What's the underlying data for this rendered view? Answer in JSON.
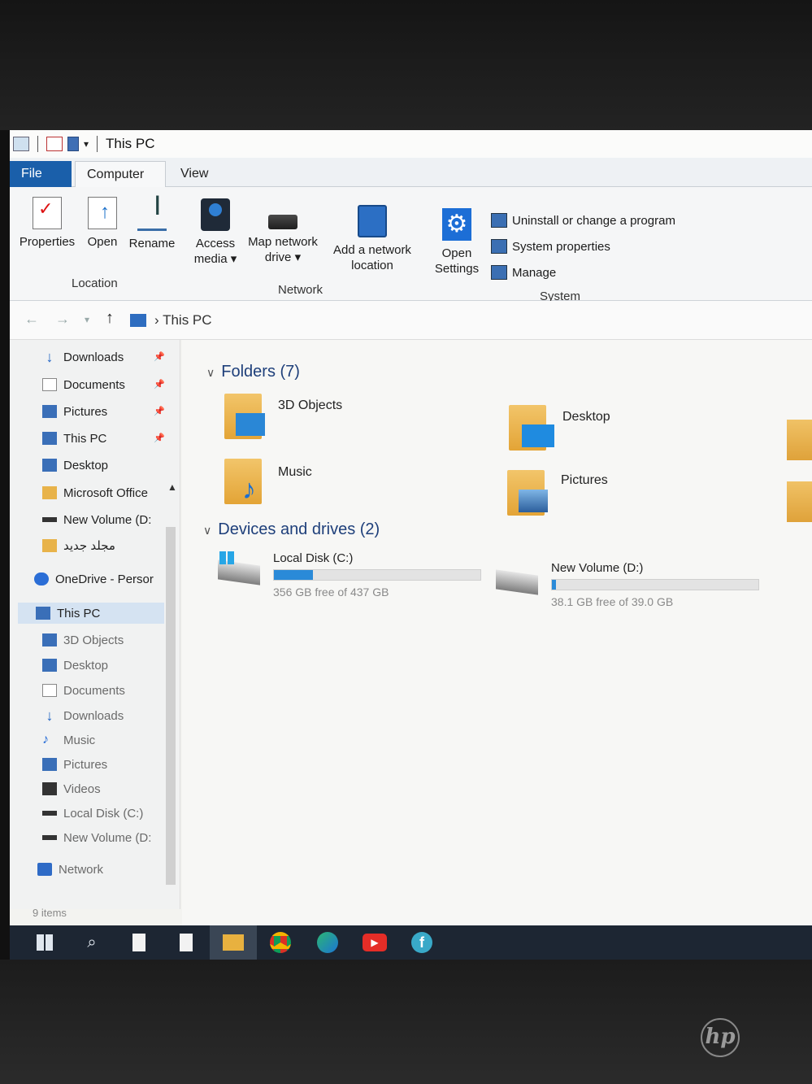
{
  "window": {
    "title": "This PC"
  },
  "tabs": [
    {
      "label": "File"
    },
    {
      "label": "Computer"
    },
    {
      "label": "View"
    }
  ],
  "ribbon": {
    "location": {
      "label": "Location",
      "buttons": [
        {
          "label": "Properties"
        },
        {
          "label": "Open"
        },
        {
          "label": "Rename"
        }
      ]
    },
    "network": {
      "label": "Network",
      "buttons": [
        {
          "label": "Access media ▾"
        },
        {
          "label": "Map network drive ▾"
        },
        {
          "label": "Add a network location"
        }
      ]
    },
    "system": {
      "label": "System",
      "open_settings": "Open Settings",
      "commands": [
        {
          "label": "Uninstall or change a program"
        },
        {
          "label": "System properties"
        },
        {
          "label": "Manage"
        }
      ]
    }
  },
  "address": {
    "path": "This PC"
  },
  "nav_pane": {
    "items": [
      {
        "label": "Downloads",
        "icon": "download-icon"
      },
      {
        "label": "Documents",
        "icon": "document-icon"
      },
      {
        "label": "Pictures",
        "icon": "pictures-icon"
      },
      {
        "label": "This PC",
        "icon": "computer-icon"
      },
      {
        "label": "Desktop",
        "icon": "desktop-icon"
      },
      {
        "label": "Microsoft Office",
        "icon": "folder-icon"
      },
      {
        "label": "New Volume (D:",
        "icon": "drive-icon"
      },
      {
        "label": "مجلد جديد",
        "icon": "folder-icon"
      },
      {
        "label": "OneDrive - Persor",
        "icon": "onedrive-icon"
      },
      {
        "label": "This PC",
        "icon": "computer-icon"
      },
      {
        "label": "3D Objects",
        "icon": "3d-objects-icon"
      },
      {
        "label": "Desktop",
        "icon": "desktop-icon"
      },
      {
        "label": "Documents",
        "icon": "document-icon"
      },
      {
        "label": "Downloads",
        "icon": "download-icon"
      },
      {
        "label": "Music",
        "icon": "music-icon"
      },
      {
        "label": "Pictures",
        "icon": "pictures-icon"
      },
      {
        "label": "Videos",
        "icon": "videos-icon"
      },
      {
        "label": "Local Disk (C:)",
        "icon": "drive-icon"
      },
      {
        "label": "New Volume (D:",
        "icon": "drive-icon"
      },
      {
        "label": "Network",
        "icon": "network-icon"
      }
    ],
    "status": "9 items"
  },
  "content": {
    "folders_header": "Folders (7)",
    "folders": [
      {
        "label": "3D Objects"
      },
      {
        "label": "Desktop"
      },
      {
        "label": "Music"
      },
      {
        "label": "Pictures"
      }
    ],
    "drives_header": "Devices and drives (2)",
    "drives": [
      {
        "label": "Local Disk (C:)",
        "free": "356 GB free of 437 GB",
        "used_fraction": 0.19
      },
      {
        "label": "New Volume (D:)",
        "free": "38.1 GB free of 39.0 GB",
        "used_fraction": 0.02
      }
    ]
  },
  "colors": {
    "file_tab": "#1a5faa",
    "accent": "#2a8ad8",
    "taskbar": "#1d2633"
  }
}
